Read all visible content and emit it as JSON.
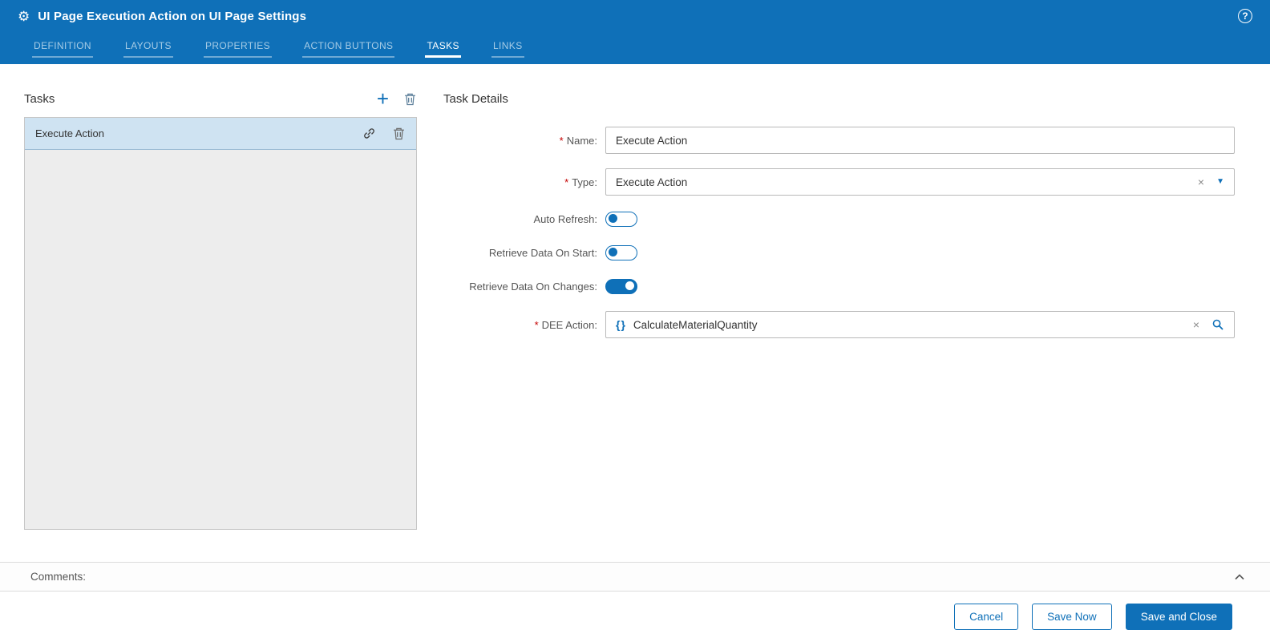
{
  "required_mark": "*",
  "icons": {
    "gear": "⚙",
    "help": "?",
    "plus": "+",
    "clear": "×",
    "caret": "▼",
    "braces": "{}"
  },
  "colors": {
    "accent": "#0f70b8",
    "header_bg": "#0f70b8",
    "required": "#c40000",
    "selected_item_bg": "#cfe3f2",
    "list_bg": "#ededed"
  },
  "header": {
    "title": "UI Page Execution Action on UI Page Settings",
    "tabs": [
      {
        "label": "DEFINITION",
        "active": false
      },
      {
        "label": "LAYOUTS",
        "active": false
      },
      {
        "label": "PROPERTIES",
        "active": false
      },
      {
        "label": "ACTION BUTTONS",
        "active": false
      },
      {
        "label": "TASKS",
        "active": true
      },
      {
        "label": "LINKS",
        "active": false
      }
    ]
  },
  "tasks_panel": {
    "title": "Tasks",
    "items": [
      {
        "label": "Execute Action",
        "selected": true
      }
    ]
  },
  "task_details": {
    "title": "Task Details",
    "fields": {
      "name": {
        "label": "Name:",
        "required": true,
        "value": "Execute Action"
      },
      "type": {
        "label": "Type:",
        "required": true,
        "value": "Execute Action"
      },
      "auto_refresh": {
        "label": "Auto Refresh:",
        "value": false
      },
      "retrieve_data_on_start": {
        "label": "Retrieve Data On Start:",
        "value": false
      },
      "retrieve_data_on_changes": {
        "label": "Retrieve Data On Changes:",
        "value": true
      },
      "dee_action": {
        "label": "DEE Action:",
        "required": true,
        "value": "CalculateMaterialQuantity"
      }
    }
  },
  "comments": {
    "label": "Comments:"
  },
  "footer": {
    "cancel_label": "Cancel",
    "save_now_label": "Save Now",
    "save_and_close_label": "Save and Close"
  }
}
